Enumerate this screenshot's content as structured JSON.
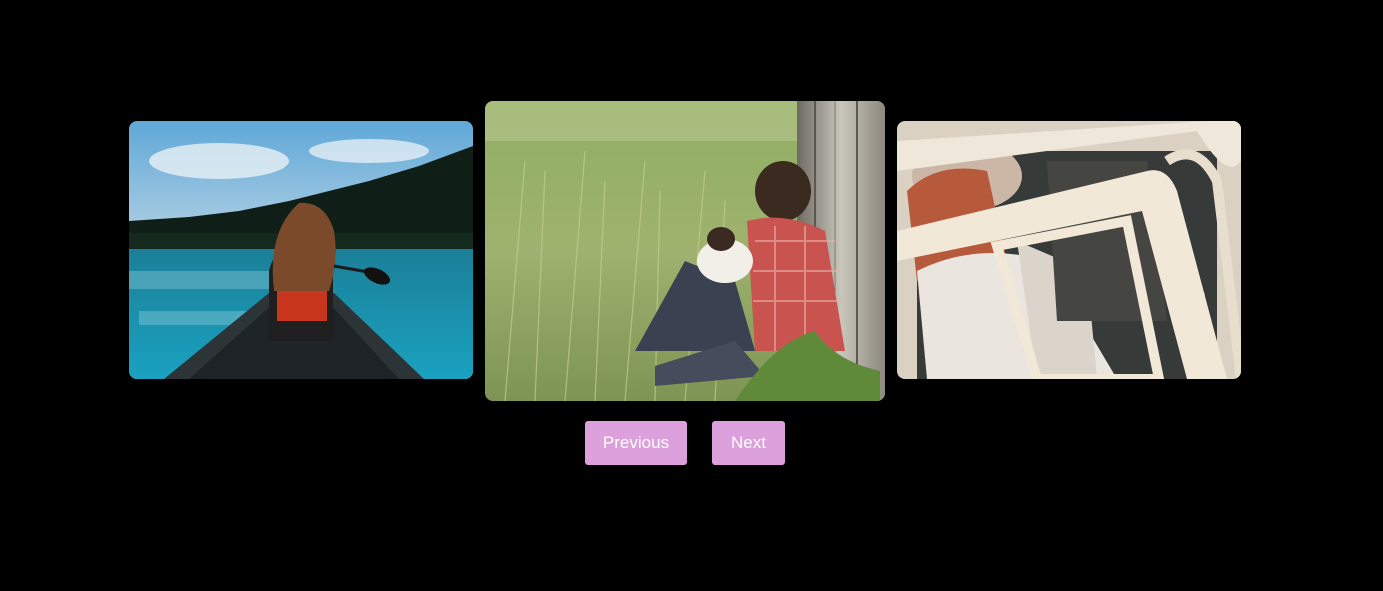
{
  "carousel": {
    "slides": [
      {
        "icon": "canoe-lake-photo"
      },
      {
        "icon": "man-with-dog-in-grass-photo"
      },
      {
        "icon": "couple-in-vintage-van-photo"
      }
    ],
    "controls": {
      "previous_label": "Previous",
      "next_label": "Next"
    }
  },
  "colors": {
    "background": "#000000",
    "button": "#dca0dc",
    "button_text": "#ffffff"
  }
}
